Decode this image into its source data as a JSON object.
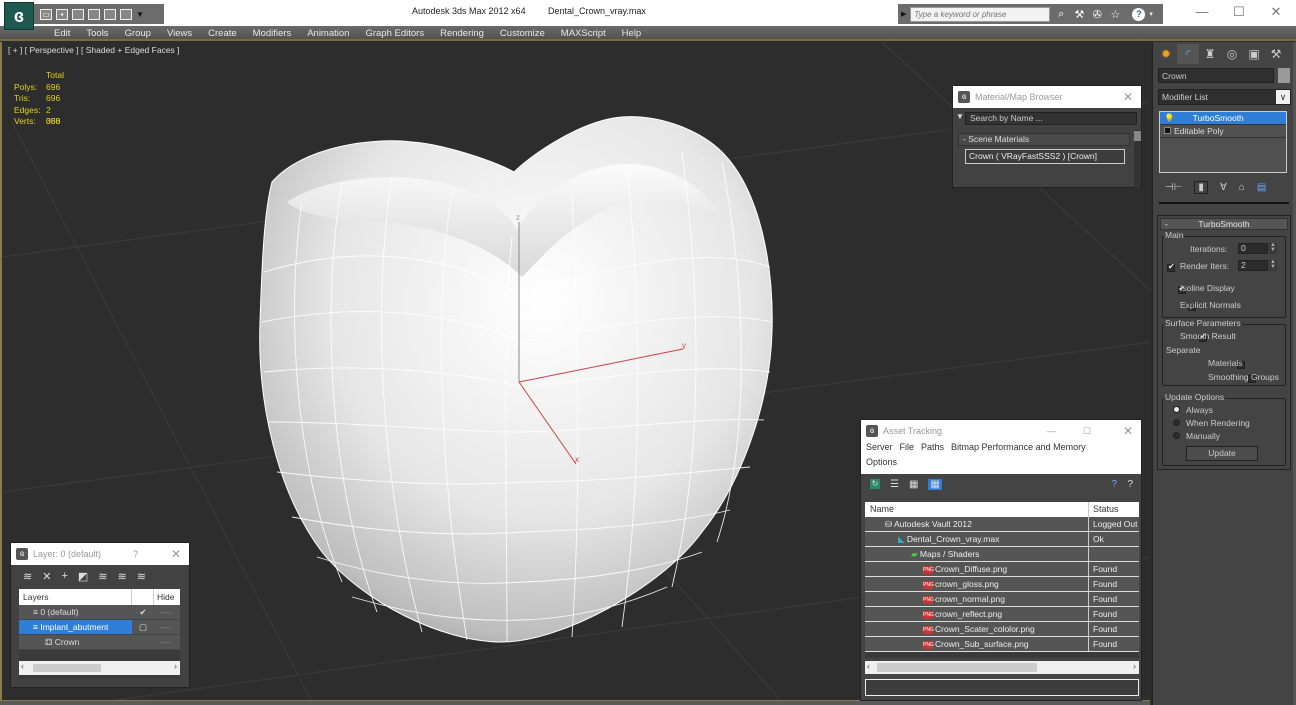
{
  "titlebar": {
    "app_title": "Autodesk 3ds Max  2012 x64",
    "document_title": "Dental_Crown_vray.max",
    "search_placeholder": "Type a keyword or phrase",
    "minimize": "—",
    "maximize": "☐",
    "close": "✕",
    "help_icon": "?"
  },
  "menubar": {
    "items": [
      "Edit",
      "Tools",
      "Group",
      "Views",
      "Create",
      "Modifiers",
      "Animation",
      "Graph Editors",
      "Rendering",
      "Customize",
      "MAXScript",
      "Help"
    ]
  },
  "viewport": {
    "label": "[ + ] [ Perspective ] [ Shaded + Edged Faces ]",
    "stats": {
      "header": "Total",
      "rows": [
        {
          "label": "Polys:",
          "value": "696"
        },
        {
          "label": "Tris:",
          "value": "696"
        },
        {
          "label": "Edges:",
          "value": "2 088"
        },
        {
          "label": "Verts:",
          "value": "350"
        }
      ]
    },
    "gizmo": {
      "x": "x",
      "y": "y",
      "z": "z"
    },
    "colors": {
      "background": "#2d2d2d",
      "axis_x": "#d04040",
      "axis_z": "#888888",
      "stats_text": "#e6d21a"
    }
  },
  "command_panel": {
    "object_name": "Crown",
    "modifier_list_label": "Modifier List",
    "stack": [
      {
        "label": "TurboSmooth",
        "selected": true
      },
      {
        "label": "Editable Poly",
        "selected": false
      }
    ],
    "rollout": {
      "title": "TurboSmooth",
      "main_group": "Main",
      "iterations_label": "Iterations:",
      "iterations_value": "0",
      "render_iters_label": "Render Iters:",
      "render_iters_value": "2",
      "render_iters_checked": true,
      "isoline_label": "Isoline Display",
      "isoline_checked": true,
      "explicit_normals_label": "Explicit Normals",
      "explicit_normals_checked": false,
      "surface_group": "Surface Parameters",
      "smooth_result_label": "Smooth Result",
      "smooth_result_checked": true,
      "separate_label": "Separate",
      "materials_label": "Materials",
      "smoothing_groups_label": "Smoothing Groups",
      "update_group": "Update Options",
      "always_label": "Always",
      "when_rendering_label": "When Rendering",
      "manually_label": "Manually",
      "update_option_selected": "Always",
      "update_button": "Update"
    },
    "accent": "#2f7fd8"
  },
  "material_browser": {
    "title": "Material/Map Browser",
    "search_placeholder": "Search by Name ...",
    "group_label": "- Scene Materials",
    "item": "Crown  ( VRayFastSSS2 )  [Crown]"
  },
  "asset_tracking": {
    "title": "Asset Tracking",
    "menu": [
      "Server",
      "File",
      "Paths",
      "Bitmap Performance and Memory",
      "Options"
    ],
    "columns": [
      "Name",
      "Status"
    ],
    "rows": [
      {
        "name": "Autodesk Vault 2012",
        "status": "Logged Out",
        "indent": 1,
        "icon": "vault-icon"
      },
      {
        "name": "Dental_Crown_vray.max",
        "status": "Ok",
        "indent": 2,
        "icon": "max-file-icon"
      },
      {
        "name": "Maps / Shaders",
        "status": "",
        "indent": 3,
        "icon": "maps-icon"
      },
      {
        "name": "Crown_Diffuse.png",
        "status": "Found",
        "indent": 4,
        "icon": "png-icon"
      },
      {
        "name": "crown_gloss.png",
        "status": "Found",
        "indent": 4,
        "icon": "png-icon"
      },
      {
        "name": "crown_normal.png",
        "status": "Found",
        "indent": 4,
        "icon": "png-icon"
      },
      {
        "name": "crown_reflect.png",
        "status": "Found",
        "indent": 4,
        "icon": "png-icon"
      },
      {
        "name": "Crown_Scater_cololor.png",
        "status": "Found",
        "indent": 4,
        "icon": "png-icon"
      },
      {
        "name": "Crown_Sub_surface.png",
        "status": "Found",
        "indent": 4,
        "icon": "png-icon"
      }
    ]
  },
  "layer_manager": {
    "title": "Layer: 0 (default)",
    "help": "?",
    "columns": [
      "Layers",
      "",
      "Hide"
    ],
    "rows": [
      {
        "name": "0 (default)",
        "current": "✔",
        "hide": "----",
        "selected": false,
        "indent": 1
      },
      {
        "name": "Implant_abutment",
        "current": "▢",
        "hide": "----",
        "selected": true,
        "indent": 1
      },
      {
        "name": "Crown",
        "current": "",
        "hide": "----",
        "selected": false,
        "indent": 2
      }
    ]
  }
}
